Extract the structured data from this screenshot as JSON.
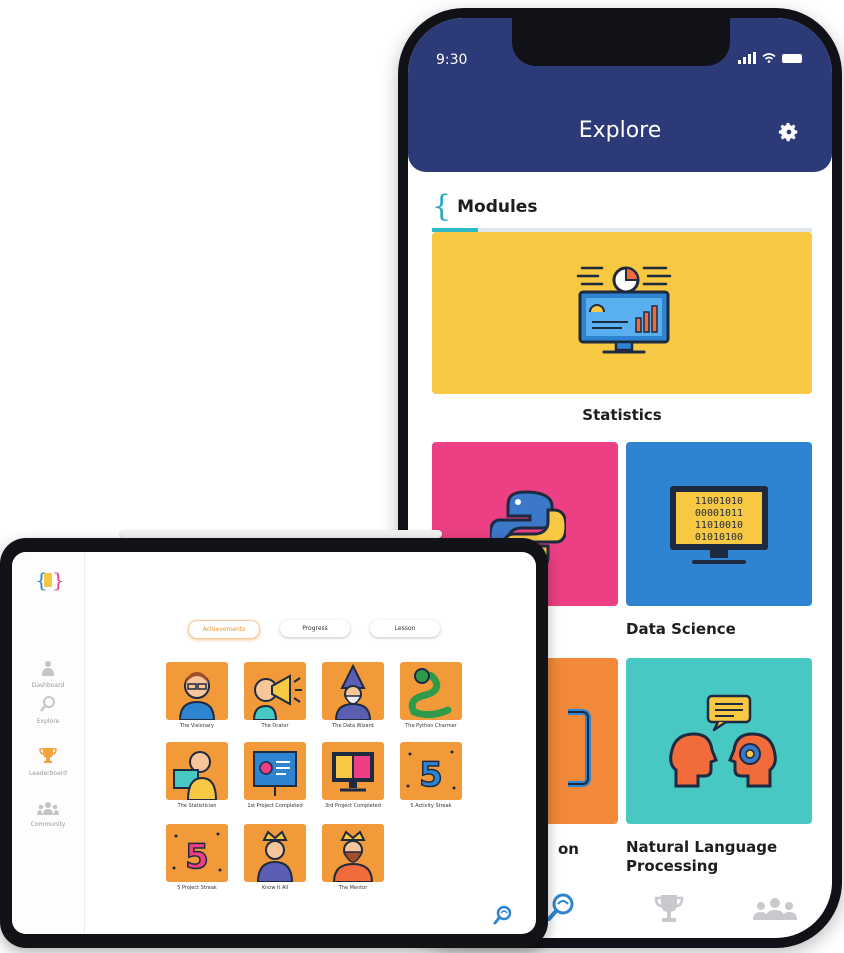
{
  "phone": {
    "status": {
      "time": "9:30"
    },
    "header": {
      "title": "Explore"
    },
    "modules_heading": {
      "brace": "{",
      "label": "Modules",
      "progress_fraction": 0.12
    },
    "cards": [
      {
        "label": "Statistics",
        "color": "#f8c842",
        "icon": "statistics-monitor-icon"
      },
      {
        "label": "",
        "color": "#ec3f84",
        "icon": "python-logo-icon"
      },
      {
        "label": "Data Science",
        "color": "#2e84d0",
        "icon": "binary-monitor-icon"
      },
      {
        "label": "on",
        "color": "#f2893a",
        "icon": "code-brackets-icon"
      },
      {
        "label": "Natural Language\nProcessing",
        "color": "#47c8c2",
        "icon": "human-ai-speech-icon"
      }
    ],
    "bottom_nav": [
      "explore-icon",
      "trophy-icon",
      "community-icon"
    ]
  },
  "tablet": {
    "sidebar": [
      {
        "label": "Dashboard",
        "icon": "dashboard-icon"
      },
      {
        "label": "Explore",
        "icon": "explore-icon"
      },
      {
        "label": "Leaderboard",
        "icon": "trophy-icon"
      },
      {
        "label": "Community",
        "icon": "community-icon"
      }
    ],
    "tabs": [
      "Achievements",
      "Progress",
      "Lesson"
    ],
    "badges": [
      {
        "caption": "The Visionary"
      },
      {
        "caption": "The Orator"
      },
      {
        "caption": "The Data Wizard"
      },
      {
        "caption": "The Python Charmer"
      },
      {
        "caption": "The Statistician"
      },
      {
        "caption": "1st Project Completed"
      },
      {
        "caption": "3rd Project Completed"
      },
      {
        "caption": "5 Activity Streak"
      },
      {
        "caption": "5 Project Streak"
      },
      {
        "caption": "Know it All"
      },
      {
        "caption": "The Mentor"
      }
    ],
    "accent_color": "#f28f2c"
  }
}
